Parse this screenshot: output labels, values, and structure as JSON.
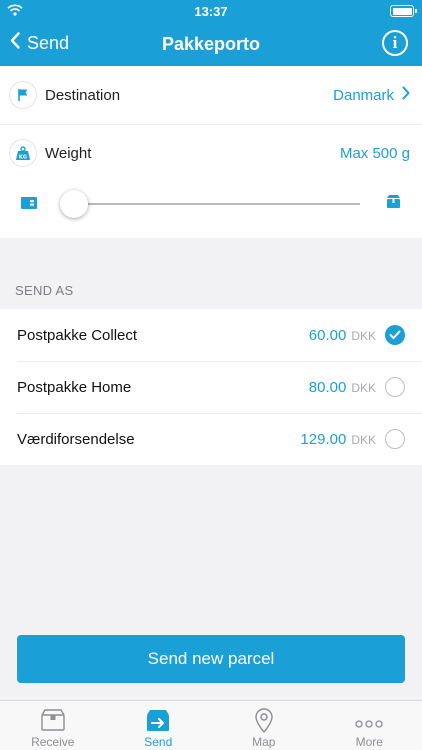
{
  "status_bar": {
    "time": "13:37"
  },
  "nav": {
    "back_label": "Send",
    "title": "Pakkeporto",
    "info_icon": "i"
  },
  "settings": {
    "destination": {
      "label": "Destination",
      "value": "Danmark"
    },
    "weight": {
      "label": "Weight",
      "value": "Max 500 g",
      "icon_text": "KG",
      "slider_level": 0
    }
  },
  "send_as": {
    "header": "SEND AS",
    "options": [
      {
        "name": "Postpakke Collect",
        "price": "60.00",
        "currency": "DKK",
        "selected": true
      },
      {
        "name": "Postpakke Home",
        "price": "80.00",
        "currency": "DKK",
        "selected": false
      },
      {
        "name": "Værdiforsendelse",
        "price": "129.00",
        "currency": "DKK",
        "selected": false
      }
    ]
  },
  "send_button": {
    "label": "Send new parcel"
  },
  "tabs": [
    {
      "label": "Receive",
      "icon": "package-icon",
      "active": false
    },
    {
      "label": "Send",
      "icon": "send-package-icon",
      "active": true
    },
    {
      "label": "Map",
      "icon": "map-pin-icon",
      "active": false
    },
    {
      "label": "More",
      "icon": "more-icon",
      "active": false
    }
  ],
  "colors": {
    "accent": "#1a9fd6",
    "background": "#f2f2f4"
  }
}
